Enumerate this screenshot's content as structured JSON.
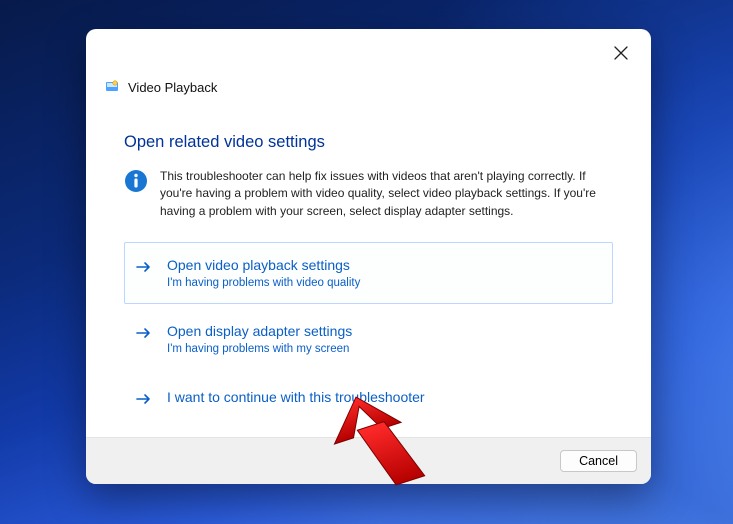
{
  "window": {
    "title": "Video Playback",
    "heading": "Open related video settings",
    "intro": "This troubleshooter can help fix issues with videos that aren't playing correctly. If you're having a problem with video quality, select video playback settings. If you're having a problem with your screen, select display adapter settings."
  },
  "options": [
    {
      "title": "Open video playback settings",
      "subtitle": "I'm having problems with video quality"
    },
    {
      "title": "Open display adapter settings",
      "subtitle": "I'm having problems with my screen"
    },
    {
      "title": "I want to continue with this troubleshooter",
      "subtitle": ""
    }
  ],
  "footer": {
    "cancel": "Cancel"
  }
}
